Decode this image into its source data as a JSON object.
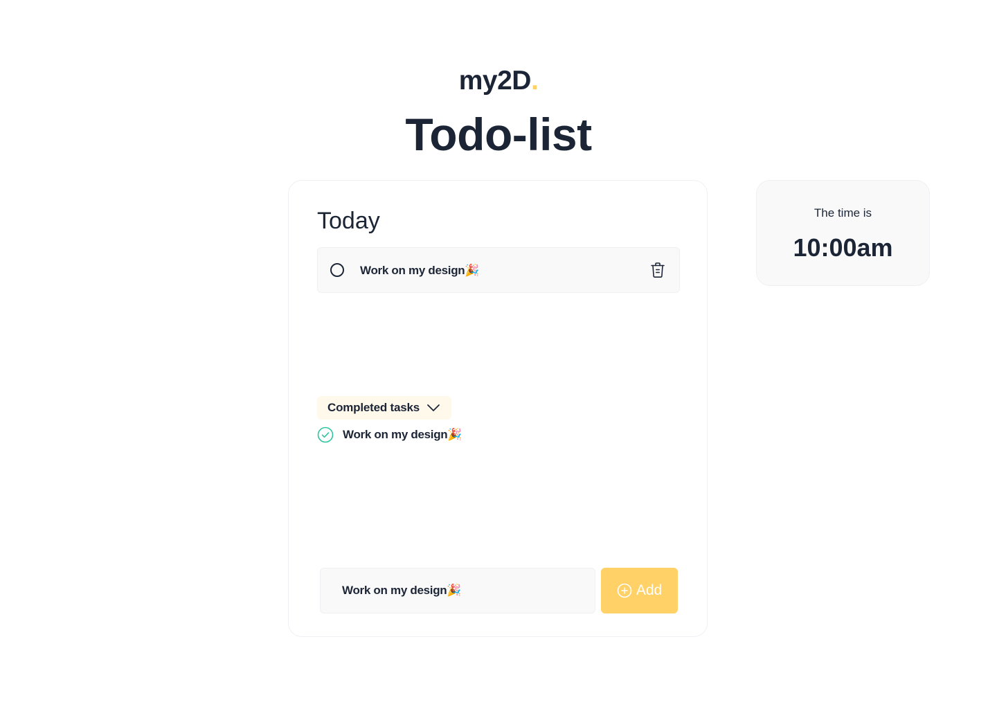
{
  "brand": {
    "name": "my2D",
    "dot": ".",
    "accent_color": "#ffd166"
  },
  "title": "Todo-list",
  "today": {
    "heading": "Today",
    "tasks": [
      {
        "label": "Work on my design🎉",
        "status": "pending",
        "delete_icon": "trash-icon"
      }
    ]
  },
  "completed": {
    "toggle_label": "Completed tasks",
    "toggle_icon": "chevron-down-icon",
    "tasks": [
      {
        "label": "Work on my design🎉",
        "status": "done",
        "icon": "check-circle-icon",
        "icon_color": "#2ec4a0"
      }
    ]
  },
  "composer": {
    "input_value": "Work on my design🎉",
    "add_label": "Add",
    "add_icon": "plus-circle-icon",
    "button_color": "#ffd166"
  },
  "clock": {
    "caption": "The time is",
    "time": "10:00am"
  },
  "colors": {
    "text": "#1c2536",
    "card_bg": "#f9f9f9",
    "completed_bg": "#fff9ec"
  }
}
